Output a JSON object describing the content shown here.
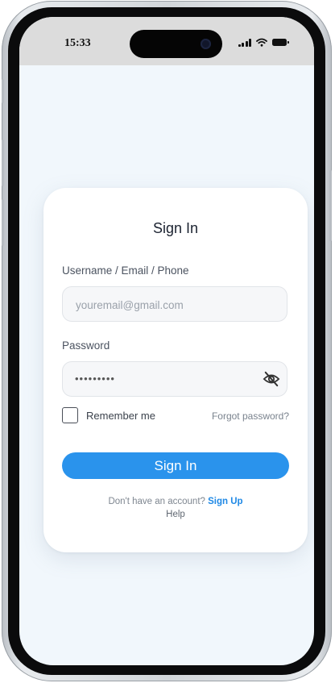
{
  "status_bar": {
    "time": "15:33"
  },
  "login": {
    "title": "Sign In",
    "username_label": "Username / Email / Phone",
    "username_placeholder": "youremail@gmail.com",
    "password_label": "Password",
    "password_masked": "•••••••••",
    "remember_label": "Remember me",
    "remember_checked": false,
    "forgot_label": "Forgot password?",
    "signin_label": "Sign In",
    "no_account_text": "Don't have an account? ",
    "signup_label": "Sign Up",
    "help_label": "Help"
  },
  "icons": {
    "password_toggle": "eye-off-icon",
    "signal": "signal-icon",
    "wifi": "wifi-icon",
    "battery": "battery-icon"
  },
  "colors": {
    "accent": "#2a93ec",
    "link": "#1e88e5",
    "screen_bg": "#f1f7fc",
    "status_bar_bg": "#dcdcdc"
  }
}
